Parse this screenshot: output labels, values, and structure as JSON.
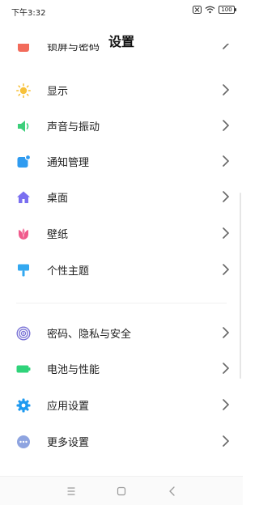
{
  "status_bar": {
    "time": "下午3:32",
    "battery": "100",
    "icons": [
      "close-box-icon",
      "wifi-icon",
      "battery-icon"
    ]
  },
  "header": {
    "title": "设置"
  },
  "partial_item": {
    "label": "锁屏与密码",
    "icon": "lock-screen-icon",
    "color": "#f26b5b"
  },
  "items": [
    {
      "label": "显示",
      "icon": "sun-icon",
      "color": "#f7c13a"
    },
    {
      "label": "声音与振动",
      "icon": "speaker-icon",
      "color": "#3ccf7a"
    },
    {
      "label": "通知管理",
      "icon": "notification-icon",
      "color": "#2f9bf0"
    },
    {
      "label": "桌面",
      "icon": "home-icon",
      "color": "#7a6ff0"
    },
    {
      "label": "壁纸",
      "icon": "tulip-icon",
      "color": "#f05a8c"
    },
    {
      "label": "个性主题",
      "icon": "brush-icon",
      "color": "#33a8f0"
    },
    {
      "label": "密码、隐私与安全",
      "icon": "fingerprint-icon",
      "color": "#7b74d6"
    },
    {
      "label": "电池与性能",
      "icon": "battery-icon",
      "color": "#2fd37a"
    },
    {
      "label": "应用设置",
      "icon": "gear-icon",
      "color": "#1e9af0"
    },
    {
      "label": "更多设置",
      "icon": "more-icon",
      "color": "#8ea4e0"
    }
  ],
  "nav": {
    "icons": [
      "menu-icon",
      "home-square-icon",
      "back-icon"
    ]
  }
}
